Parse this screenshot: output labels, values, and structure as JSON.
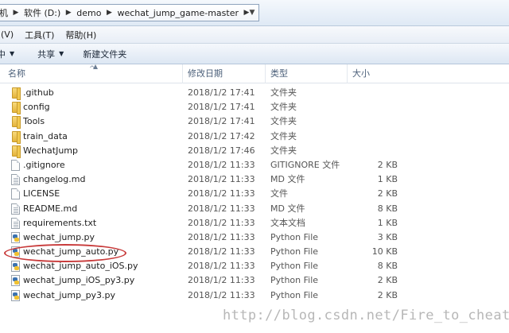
{
  "address_bar": {
    "crumbs": [
      "机",
      "软件 (D:)",
      "demo",
      "wechat_jump_game-master"
    ]
  },
  "menu": [
    "(V)",
    "工具(T)",
    "帮助(H)"
  ],
  "command_bar": {
    "organize_label": "中",
    "share_label": "共享",
    "new_folder_label": "新建文件夹"
  },
  "columns": {
    "name": "名称",
    "date": "修改日期",
    "type": "类型",
    "size": "大小"
  },
  "files": [
    {
      "name": ".github",
      "date": "2018/1/2 17:41",
      "type": "文件夹",
      "size": "",
      "icon": "folder-icon"
    },
    {
      "name": "config",
      "date": "2018/1/2 17:41",
      "type": "文件夹",
      "size": "",
      "icon": "folder-icon"
    },
    {
      "name": "Tools",
      "date": "2018/1/2 17:41",
      "type": "文件夹",
      "size": "",
      "icon": "folder-icon"
    },
    {
      "name": "train_data",
      "date": "2018/1/2 17:42",
      "type": "文件夹",
      "size": "",
      "icon": "folder-icon"
    },
    {
      "name": "WechatJump",
      "date": "2018/1/2 17:46",
      "type": "文件夹",
      "size": "",
      "icon": "folder-icon"
    },
    {
      "name": ".gitignore",
      "date": "2018/1/2 11:33",
      "type": "GITIGNORE 文件",
      "size": "2 KB",
      "icon": "file-icon"
    },
    {
      "name": "changelog.md",
      "date": "2018/1/2 11:33",
      "type": "MD 文件",
      "size": "1 KB",
      "icon": "file-icon"
    },
    {
      "name": "LICENSE",
      "date": "2018/1/2 11:33",
      "type": "文件",
      "size": "2 KB",
      "icon": "file-icon"
    },
    {
      "name": "README.md",
      "date": "2018/1/2 11:33",
      "type": "MD 文件",
      "size": "8 KB",
      "icon": "file-icon"
    },
    {
      "name": "requirements.txt",
      "date": "2018/1/2 11:33",
      "type": "文本文档",
      "size": "1 KB",
      "icon": "text-file-icon"
    },
    {
      "name": "wechat_jump.py",
      "date": "2018/1/2 11:33",
      "type": "Python File",
      "size": "3 KB",
      "icon": "python-file-icon"
    },
    {
      "name": "wechat_jump_auto.py",
      "date": "2018/1/2 11:33",
      "type": "Python File",
      "size": "10 KB",
      "icon": "python-file-icon"
    },
    {
      "name": "wechat_jump_auto_iOS.py",
      "date": "2018/1/2 11:33",
      "type": "Python File",
      "size": "8 KB",
      "icon": "python-file-icon"
    },
    {
      "name": "wechat_jump_iOS_py3.py",
      "date": "2018/1/2 11:33",
      "type": "Python File",
      "size": "2 KB",
      "icon": "python-file-icon"
    },
    {
      "name": "wechat_jump_py3.py",
      "date": "2018/1/2 11:33",
      "type": "Python File",
      "size": "2 KB",
      "icon": "python-file-icon"
    }
  ],
  "watermark": "http://blog.csdn.net/Fire_to_cheat_",
  "colors": {
    "highlight_ring": "#c83a3a",
    "folder": "#e4b33b",
    "python_blue": "#3c73b0",
    "python_yellow": "#f1c232"
  }
}
